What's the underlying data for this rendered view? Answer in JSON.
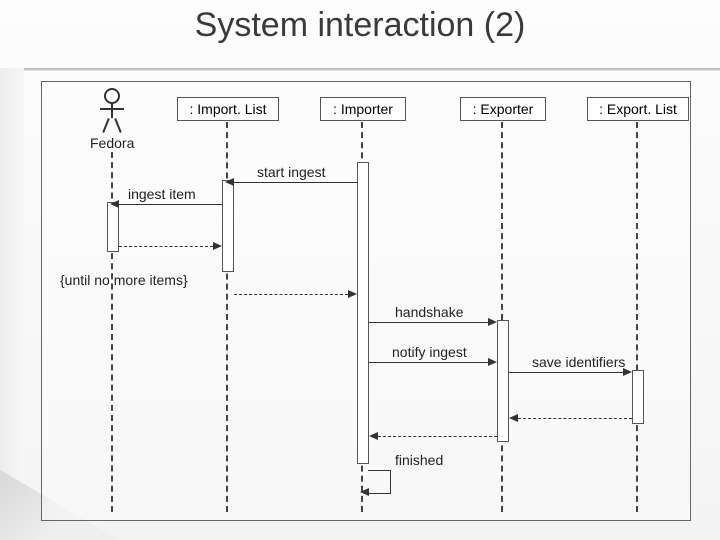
{
  "title": "System interaction (2)",
  "actors": {
    "fedora": "Fedora",
    "importList": ": Import. List",
    "importer": ": Importer",
    "exporter": ": Exporter",
    "exportList": ": Export. List"
  },
  "messages": {
    "startIngest": "start ingest",
    "ingestItem": "ingest item",
    "loopGuard": "{until no more items}",
    "handshake": "handshake",
    "notifyIngest": "notify ingest",
    "saveIdentifiers": "save identifiers",
    "finished": "finished"
  }
}
